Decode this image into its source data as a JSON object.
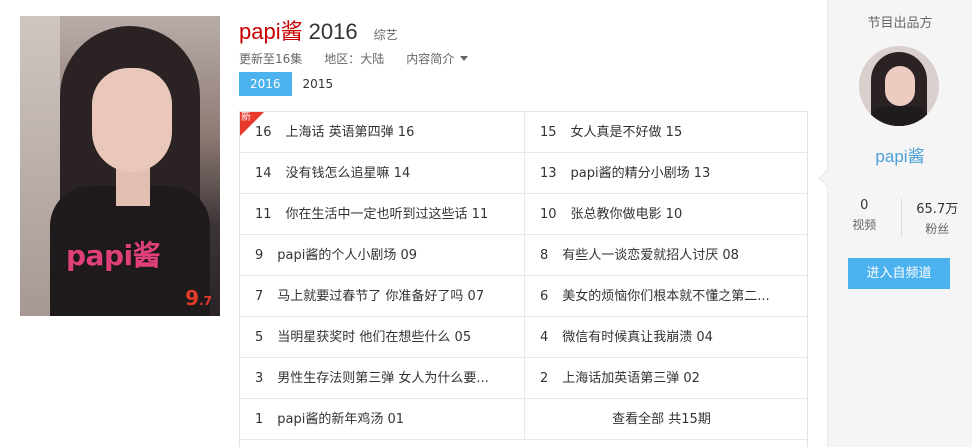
{
  "show": {
    "title": "papi酱",
    "year": "2016",
    "genre": "综艺",
    "updated": "更新至16集",
    "region": "地区：大陆",
    "intro_label": "内容简介",
    "poster_logo": "papi酱",
    "score_main": "9",
    "score_dec": ".7"
  },
  "year_tabs": [
    {
      "label": "2016",
      "active": true
    },
    {
      "label": "2015",
      "active": false
    }
  ],
  "new_badge": "新",
  "episodes_left": [
    {
      "num": "16",
      "title": "上海话 英语第四弹 16"
    },
    {
      "num": "14",
      "title": "没有钱怎么追星嘛 14"
    },
    {
      "num": "11",
      "title": "你在生活中一定也听到过这些话 11"
    },
    {
      "num": "9",
      "title": "papi酱的个人小剧场 09"
    },
    {
      "num": "7",
      "title": "马上就要过春节了 你准备好了吗 07"
    },
    {
      "num": "5",
      "title": "当明星获奖时 他们在想些什么 05"
    },
    {
      "num": "3",
      "title": "男性生存法则第三弹 女人为什么要..."
    },
    {
      "num": "1",
      "title": "papi酱的新年鸡汤 01"
    }
  ],
  "episodes_right": [
    {
      "num": "15",
      "title": "女人真是不好做 15"
    },
    {
      "num": "13",
      "title": "papi酱的精分小剧场 13"
    },
    {
      "num": "10",
      "title": "张总教你做电影 10"
    },
    {
      "num": "8",
      "title": "有些人一谈恋爱就招人讨厌 08"
    },
    {
      "num": "6",
      "title": "美女的烦恼你们根本就不懂之第二..."
    },
    {
      "num": "4",
      "title": "微信有时候真让我崩溃 04"
    },
    {
      "num": "2",
      "title": "上海话加英语第三弹 02"
    }
  ],
  "view_all": "查看全部 共15期",
  "side": {
    "title": "节目出品方",
    "channel_name": "papi酱",
    "videos_count": "0",
    "videos_label": "视频",
    "fans_count": "65.7万",
    "fans_label": "粉丝",
    "enter_button": "进入自频道"
  }
}
